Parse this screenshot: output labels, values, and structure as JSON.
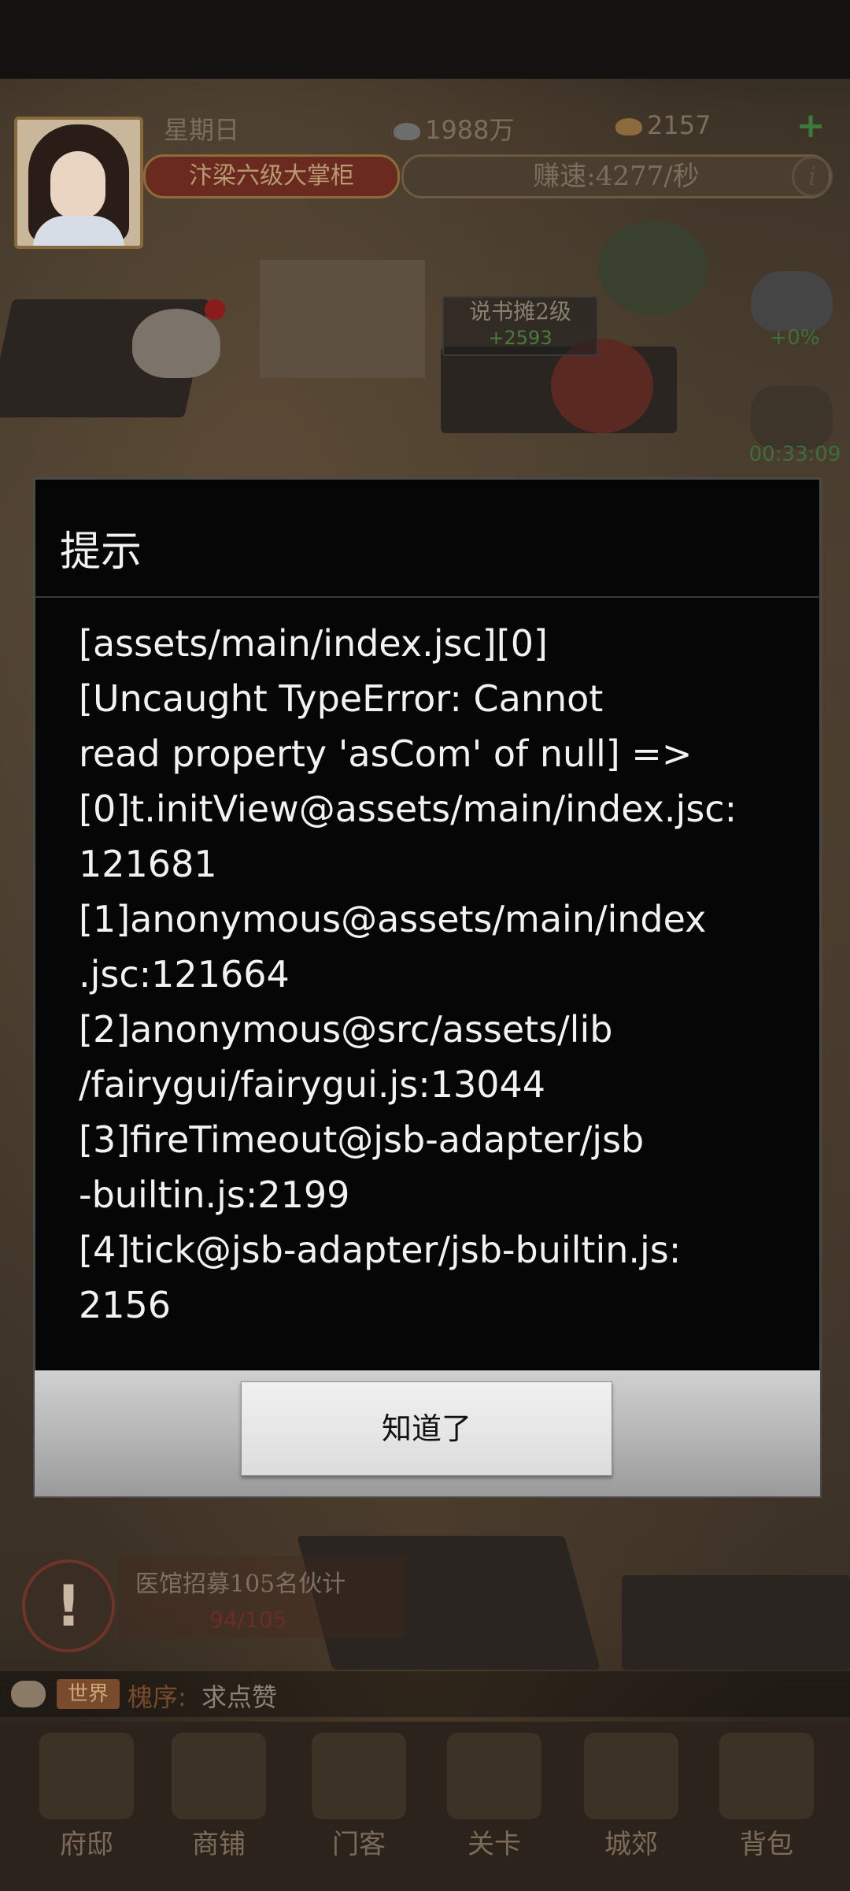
{
  "status": {
    "weekday": "星期日",
    "rank": "汴梁六级大掌柜",
    "silver": "1988万",
    "gold": "2157",
    "earn_rate": "赚速:4277/秒",
    "info_label": "i"
  },
  "map": {
    "story_label": "说书摊2级",
    "story_gain": "+2593",
    "ingot_bonus": "+0%",
    "timer": "00:33:09"
  },
  "dialog": {
    "title": "提示",
    "lines": [
      "[assets/main/index.jsc][0]",
      "[Uncaught TypeError: Cannot",
      "read property 'asCom' of null] =>",
      "[0]t.initView@assets/main/index.jsc:",
      "121681",
      "[1]anonymous@assets/main/index",
      ".jsc:121664",
      "[2]anonymous@src/assets/lib",
      "/fairygui/fairygui.js:13044",
      "[3]fireTimeout@jsb-adapter/jsb",
      "-builtin.js:2199",
      "[4]tick@jsb-adapter/jsb-builtin.js:",
      "2156"
    ],
    "ok_label": "知道了"
  },
  "task": {
    "icon": "!",
    "title": "医馆招募105名伙计",
    "progress": "94/105"
  },
  "chat": {
    "channel": "世界",
    "sender": "槐序:",
    "message": "求点赞"
  },
  "nav": [
    {
      "label": "府邸"
    },
    {
      "label": "商铺"
    },
    {
      "label": "门客"
    },
    {
      "label": "关卡"
    },
    {
      "label": "城郊"
    },
    {
      "label": "背包"
    }
  ]
}
